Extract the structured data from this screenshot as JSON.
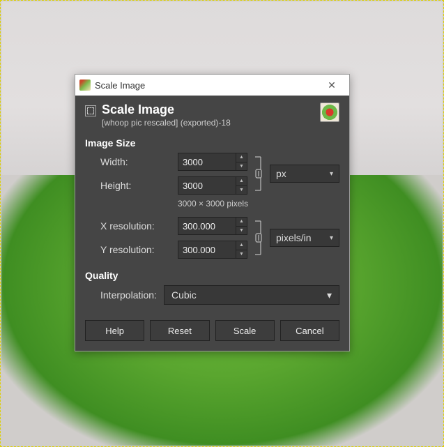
{
  "window": {
    "title": "Scale Image"
  },
  "header": {
    "title": "Scale Image",
    "subtitle": "[whoop pic rescaled] (exported)-18"
  },
  "sections": {
    "image_size": "Image Size",
    "quality": "Quality"
  },
  "fields": {
    "width_label": "Width:",
    "width_value": "3000",
    "height_label": "Height:",
    "height_value": "3000",
    "size_unit": "px",
    "dimensions_text": "3000 × 3000 pixels",
    "xres_label": "X resolution:",
    "xres_value": "300.000",
    "yres_label": "Y resolution:",
    "yres_value": "300.000",
    "res_unit": "pixels/in",
    "interp_label": "Interpolation:",
    "interp_value": "Cubic"
  },
  "buttons": {
    "help": "Help",
    "reset": "Reset",
    "scale": "Scale",
    "cancel": "Cancel"
  }
}
